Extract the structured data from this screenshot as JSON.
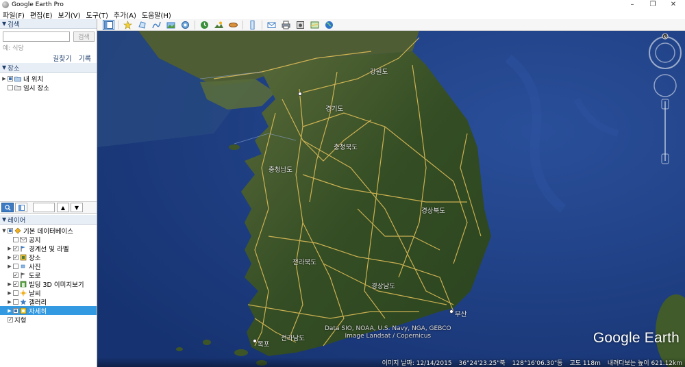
{
  "window": {
    "title": "Google Earth Pro",
    "minimize": "–",
    "maximize": "❐",
    "close": "✕"
  },
  "menu": [
    "파일(F)",
    "편집(E)",
    "보기(V)",
    "도구(T)",
    "추가(A)",
    "도움말(H)"
  ],
  "toolbar": {
    "buttons": [
      "sidebar-icon",
      "placemark-icon",
      "polygon-icon",
      "path-icon",
      "image-overlay-icon",
      "record-tour-icon",
      "historical-imagery-icon",
      "sunlight-icon",
      "planets-icon",
      "ruler-icon",
      "email-icon",
      "print-icon",
      "save-image-icon",
      "view-in-maps-icon",
      "earth-icon"
    ]
  },
  "search": {
    "header": "검색",
    "placeholder": "",
    "button": "검색",
    "hint": "예: 식당",
    "links": [
      "길찾기",
      "기록"
    ]
  },
  "places": {
    "header": "장소",
    "items": [
      {
        "label": "내 위치",
        "checked": "partial",
        "icon": "folder-icon"
      },
      {
        "label": "임시 장소",
        "checked": "none",
        "icon": "folder-icon"
      }
    ]
  },
  "layers": {
    "header": "레이어",
    "items": [
      {
        "label": "기본 데이터베이스",
        "checked": "partial",
        "icon": "database-icon",
        "indent": 0
      },
      {
        "label": "공지",
        "checked": "none",
        "icon": "mail-icon",
        "indent": 1
      },
      {
        "label": "경계선 및 라벨",
        "checked": "checked",
        "icon": "flag-icon",
        "indent": 1
      },
      {
        "label": "장소",
        "checked": "checked",
        "icon": "place-icon",
        "indent": 1
      },
      {
        "label": "사진",
        "checked": "none",
        "icon": "photo-icon",
        "indent": 1
      },
      {
        "label": "도로",
        "checked": "checked",
        "icon": "road-icon",
        "indent": 1
      },
      {
        "label": "빌딩 3D 이미지보기",
        "checked": "checked",
        "icon": "building-icon",
        "indent": 1
      },
      {
        "label": "날씨",
        "checked": "none",
        "icon": "weather-icon",
        "indent": 1
      },
      {
        "label": "갤러리",
        "checked": "none",
        "icon": "gallery-icon",
        "indent": 1
      },
      {
        "label": "자세히",
        "checked": "partial",
        "icon": "more-icon",
        "indent": 1,
        "selected": true
      },
      {
        "label": "지형",
        "checked": "checked",
        "icon": "",
        "indent": 0
      }
    ]
  },
  "map": {
    "labels": [
      {
        "text": "강원도",
        "cls": "lbl-gangwon"
      },
      {
        "text": "경기도",
        "cls": "lbl-gyeonggi"
      },
      {
        "text": "충청북도",
        "cls": "lbl-chungbuk"
      },
      {
        "text": "충청남도",
        "cls": "lbl-chungnam"
      },
      {
        "text": "경상북도",
        "cls": "lbl-gyeongbuk"
      },
      {
        "text": "전라북도",
        "cls": "lbl-jeonbuk"
      },
      {
        "text": "경상남도",
        "cls": "lbl-gyeongnam"
      },
      {
        "text": "전라남도",
        "cls": "lbl-jeonnam"
      },
      {
        "text": "부산",
        "cls": "lbl-busan"
      },
      {
        "text": "목포",
        "cls": "lbl-mokpo"
      }
    ],
    "credits": [
      "Data SIO, NOAA, U.S. Navy, NGA, GEBCO",
      "Image Landsat / Copernicus"
    ],
    "logo": "Google Earth"
  },
  "status": {
    "imagery_date": "이미지 날짜: 12/14/2015",
    "lat": "36°24'23.25\"북",
    "lon": "128°16'06.30\"동",
    "elev": "고도    118m",
    "eye_alt": "내려다보는 높이 621.12km"
  },
  "colors": {
    "sea": "#1e3c82",
    "land": "#3b5527",
    "roads": "#e6c25a",
    "selection": "#3399e0",
    "panel_header": "#e8eef6"
  }
}
